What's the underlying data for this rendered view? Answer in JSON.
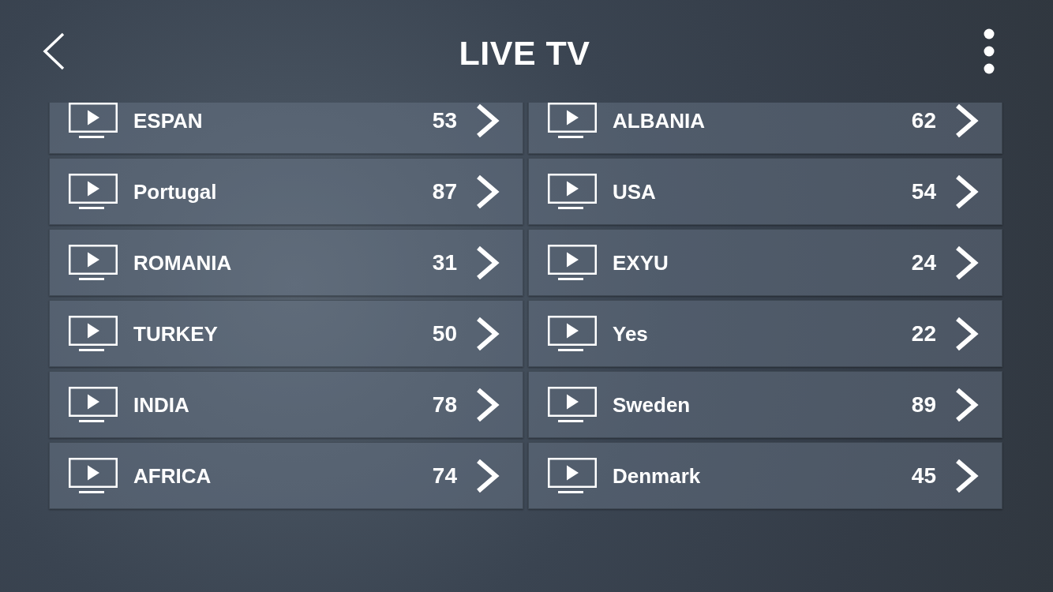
{
  "header": {
    "title": "LIVE TV"
  },
  "categories": [
    {
      "name": "ESPAN",
      "count": "53"
    },
    {
      "name": "ALBANIA",
      "count": "62"
    },
    {
      "name": "Portugal",
      "count": "87"
    },
    {
      "name": "USA",
      "count": "54"
    },
    {
      "name": "ROMANIA",
      "count": "31"
    },
    {
      "name": "EXYU",
      "count": "24"
    },
    {
      "name": "TURKEY",
      "count": "50"
    },
    {
      "name": "Yes",
      "count": "22"
    },
    {
      "name": "INDIA",
      "count": "78"
    },
    {
      "name": "Sweden",
      "count": "89"
    },
    {
      "name": "AFRICA",
      "count": "74"
    },
    {
      "name": "Denmark",
      "count": "45"
    }
  ]
}
